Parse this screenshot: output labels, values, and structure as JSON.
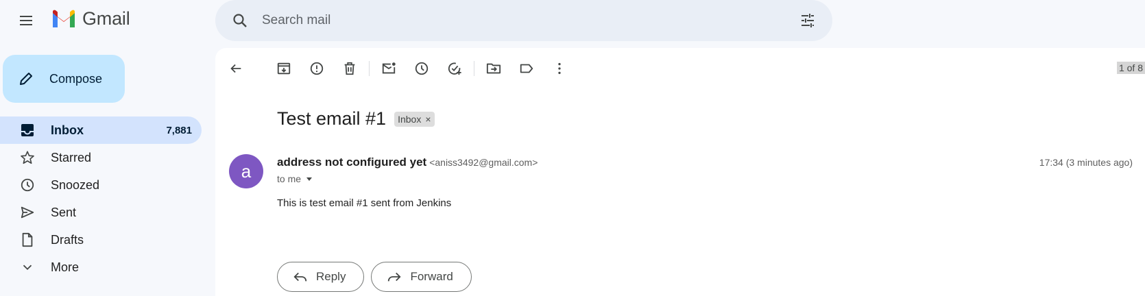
{
  "app": {
    "name": "Gmail"
  },
  "icons": {
    "menu": "menu-icon",
    "logo": "gmail-logo-icon",
    "search": "search-icon",
    "filters": "tune-icon"
  },
  "search": {
    "placeholder": "Search mail"
  },
  "compose": {
    "label": "Compose"
  },
  "nav": [
    {
      "label": "Inbox",
      "count": "7,881",
      "icon": "inbox-icon",
      "active": true
    },
    {
      "label": "Starred",
      "count": "",
      "icon": "star-icon"
    },
    {
      "label": "Snoozed",
      "count": "",
      "icon": "clock-icon"
    },
    {
      "label": "Sent",
      "count": "",
      "icon": "send-icon"
    },
    {
      "label": "Drafts",
      "count": "",
      "icon": "draft-icon"
    },
    {
      "label": "More",
      "count": "",
      "icon": "chevron-down-icon"
    }
  ],
  "toolbar": {
    "buttons": [
      "back-icon",
      "archive-icon",
      "report-spam-icon",
      "delete-icon",
      "mark-unread-icon",
      "snooze-icon",
      "add-task-icon",
      "move-to-icon",
      "label-icon",
      "more-vert-icon"
    ],
    "pager": "1 of 8"
  },
  "message": {
    "subject": "Test email #1",
    "label_chip": "Inbox",
    "chip_close": "×",
    "avatar_letter": "a",
    "sender_name": "address not configured yet",
    "sender_email": "<aniss3492@gmail.com>",
    "timestamp": "17:34 (3 minutes ago)",
    "recipient": "to me",
    "body": "This is test email #1 sent from Jenkins"
  },
  "actions": {
    "reply": "Reply",
    "forward": "Forward"
  },
  "colors": {
    "accent": "#c2e7ff",
    "active_nav": "#d3e3fd",
    "avatar": "#7e57c2",
    "search_bg": "#e9eef6"
  }
}
